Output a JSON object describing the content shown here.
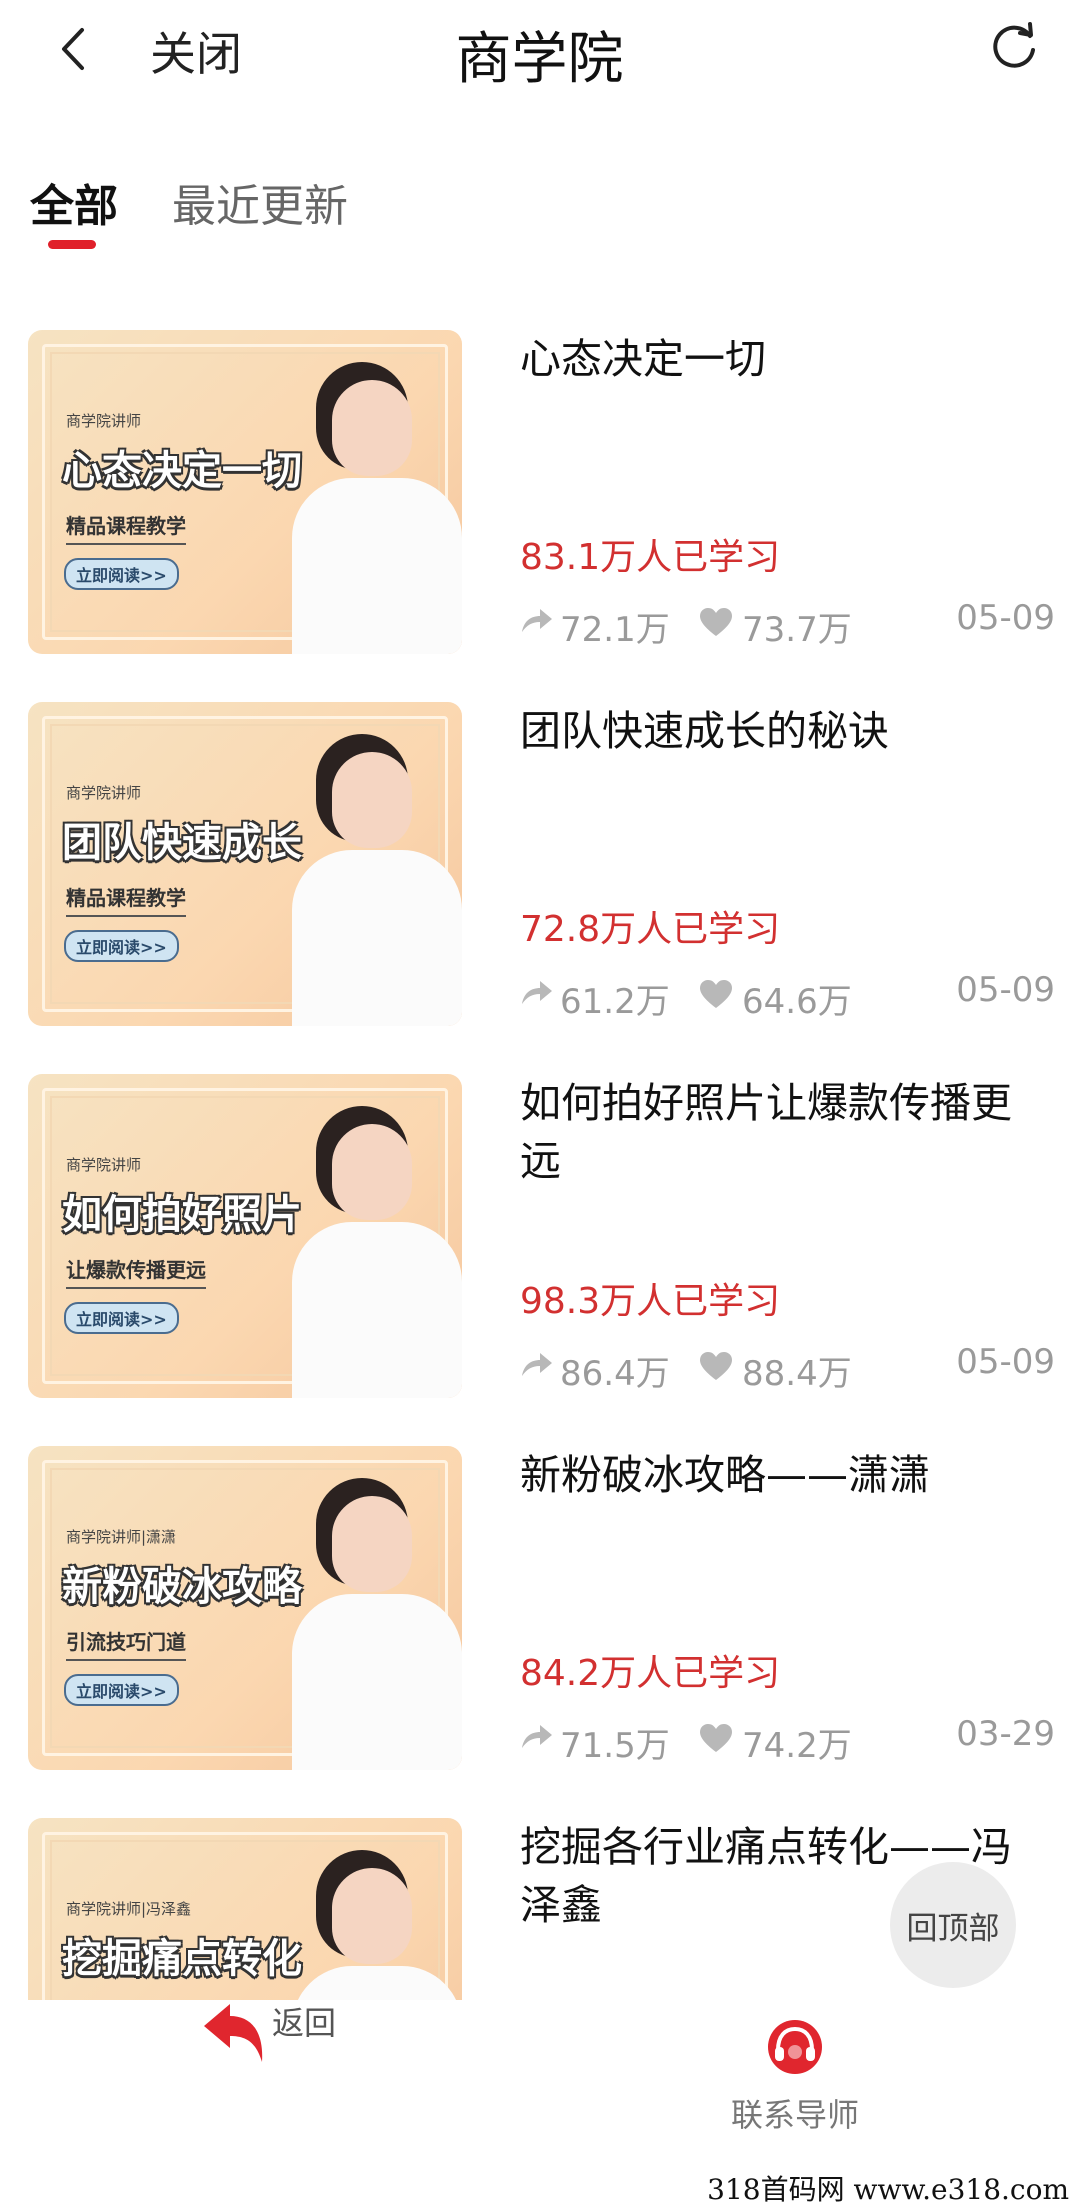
{
  "header": {
    "close_label": "关闭",
    "title": "商学院"
  },
  "tabs": [
    {
      "label": "全部",
      "active": true
    },
    {
      "label": "最近更新",
      "active": false
    }
  ],
  "accent_color": "#e0202a",
  "items": [
    {
      "title": "心态决定一切",
      "learners": "83.1万人已学习",
      "shares": "72.1万",
      "likes": "73.7万",
      "date": "05-09",
      "thumb_tag": "商学院讲师",
      "thumb_title": "心态决定一切",
      "thumb_subtitle": "精品课程教学",
      "thumb_button": "立即阅读>>"
    },
    {
      "title": "团队快速成长的秘诀",
      "learners": "72.8万人已学习",
      "shares": "61.2万",
      "likes": "64.6万",
      "date": "05-09",
      "thumb_tag": "商学院讲师",
      "thumb_title": "团队快速成长",
      "thumb_subtitle": "精品课程教学",
      "thumb_button": "立即阅读>>"
    },
    {
      "title": "如何拍好照片让爆款传播更远",
      "learners": "98.3万人已学习",
      "shares": "86.4万",
      "likes": "88.4万",
      "date": "05-09",
      "thumb_tag": "商学院讲师",
      "thumb_title": "如何拍好照片",
      "thumb_subtitle": "让爆款传播更远",
      "thumb_button": "立即阅读>>"
    },
    {
      "title": "新粉破冰攻略——潇潇",
      "learners": "84.2万人已学习",
      "shares": "71.5万",
      "likes": "74.2万",
      "date": "03-29",
      "thumb_tag": "商学院讲师|潇潇",
      "thumb_title": "新粉破冰攻略",
      "thumb_subtitle": "引流技巧门道",
      "thumb_button": "立即阅读>>"
    },
    {
      "title": "挖掘各行业痛点转化——冯泽鑫",
      "learners": "",
      "shares": "",
      "likes": "",
      "date": "",
      "thumb_tag": "商学院讲师|冯泽鑫",
      "thumb_title": "挖掘痛点转化",
      "thumb_subtitle": "",
      "thumb_button": ""
    }
  ],
  "back_to_top_label": "回顶部",
  "bottom_nav": {
    "back_label": "返回",
    "contact_label": "联系导师"
  },
  "watermark": "318首码网  www.e318.com",
  "icons": {
    "back": "chevron-left-icon",
    "refresh": "refresh-icon",
    "share": "share-icon",
    "like": "heart-icon",
    "nav_back": "return-arrow-icon",
    "contact": "headset-icon"
  }
}
